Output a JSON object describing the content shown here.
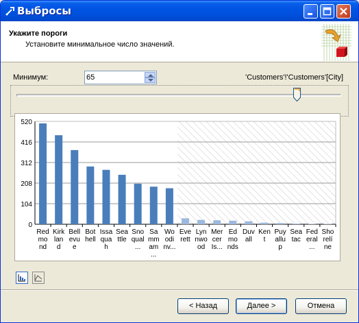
{
  "window": {
    "title": "Выбросы"
  },
  "header": {
    "title": "Укажите пороги",
    "subtitle": "Установите минимальное число значений."
  },
  "minimum": {
    "label": "Минимум:",
    "value": "65"
  },
  "field_name": "'Customers'!'Customers'[City]",
  "slider": {
    "value": 65
  },
  "chart_data": {
    "type": "bar",
    "categories": [
      "Redmond",
      "Kirkland",
      "Bellevue",
      "Bothell",
      "Issaquah",
      "Seattle",
      "Snoqualmie",
      "Sammamish",
      "Woodinville",
      "Everett",
      "Lynnwood",
      "Mercer Island",
      "Edmonds",
      "Duvall",
      "Kent",
      "Puyallup",
      "Seatac",
      "Federal Way",
      "Shoreline"
    ],
    "category_labels": [
      [
        "Red",
        "mo",
        "nd"
      ],
      [
        "Kirk",
        "lan",
        "d"
      ],
      [
        "Bell",
        "evu",
        "e"
      ],
      [
        "Bot",
        "hell"
      ],
      [
        "Issa",
        "qua",
        "h"
      ],
      [
        "Sea",
        "ttle"
      ],
      [
        "Sno",
        "qual",
        "..."
      ],
      [
        "Sa",
        "mm",
        "am",
        "..."
      ],
      [
        "Wo",
        "odi",
        "nv..."
      ],
      [
        "Eve",
        "rett"
      ],
      [
        "Lyn",
        "nwo",
        "od"
      ],
      [
        "Mer",
        "cer",
        "Is..."
      ],
      [
        "Ed",
        "mo",
        "nds"
      ],
      [
        "Duv",
        "all"
      ],
      [
        "Ken",
        "t"
      ],
      [
        "Puy",
        "allu",
        "p"
      ],
      [
        "Sea",
        "tac"
      ],
      [
        "Fed",
        "eral",
        "..."
      ],
      [
        "Sho",
        "relí",
        "ne"
      ]
    ],
    "values": [
      510,
      450,
      375,
      292,
      275,
      250,
      205,
      190,
      182,
      30,
      22,
      20,
      18,
      15,
      8,
      6,
      3,
      2,
      2
    ],
    "yticks": [
      0,
      104,
      208,
      312,
      416,
      520
    ],
    "ylim": [
      0,
      520
    ],
    "excluded_from_index": 9,
    "grid": true,
    "colors": {
      "included": "#4A7EBB",
      "excluded": "#9DB8DE",
      "excluded_hatch": "#C8C8C8"
    }
  },
  "view_buttons": {
    "histogram": "histogram-icon",
    "curve": "curve-icon"
  },
  "buttons": {
    "back": "< Назад",
    "next": "Далее >",
    "cancel": "Отмена"
  }
}
